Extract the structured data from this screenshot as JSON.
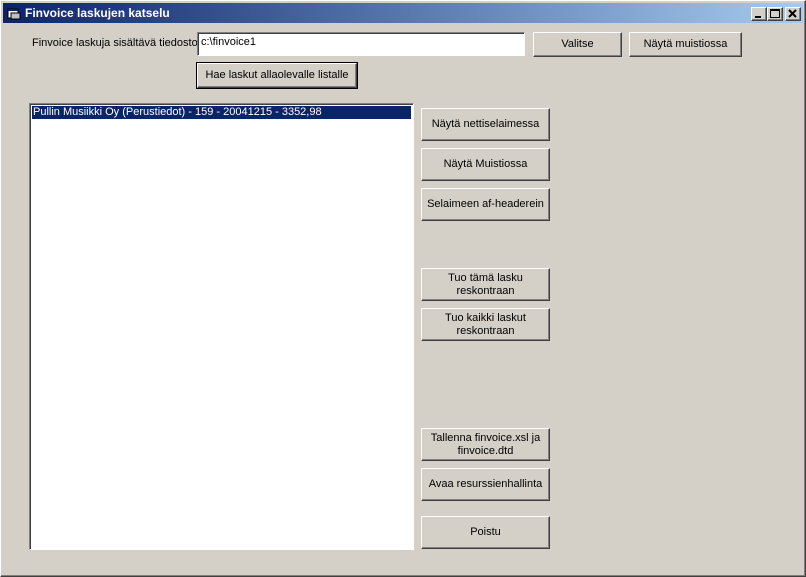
{
  "window": {
    "title": "Finvoice laskujen katselu"
  },
  "file_section": {
    "label": "Finvoice laskuja sisältävä tiedosto",
    "path_value": "c:\\finvoice1",
    "choose_label": "Valitse",
    "show_notepad_label": "Näytä muistiossa",
    "fetch_label": "Hae laskut allaolevalle listalle"
  },
  "invoice_list": [
    {
      "text": "Pullin Musiikki Oy (Perustiedot) - 159 - 20041215 - 3352,98",
      "selected": true
    }
  ],
  "actions": {
    "show_browser": "Näytä nettiselaimessa",
    "show_notepad": "Näytä Muistiossa",
    "browser_af_headers": "Selaimeen af-headerein",
    "import_this_line1": "Tuo tämä lasku",
    "import_this_line2": "reskontraan",
    "import_all_line1": "Tuo kaikki laskut",
    "import_all_line2": "reskontraan",
    "save_line1": "Tallenna finvoice.xsl ja",
    "save_line2": "finvoice.dtd",
    "open_explorer": "Avaa resurssienhallinta",
    "exit": "Poistu"
  }
}
